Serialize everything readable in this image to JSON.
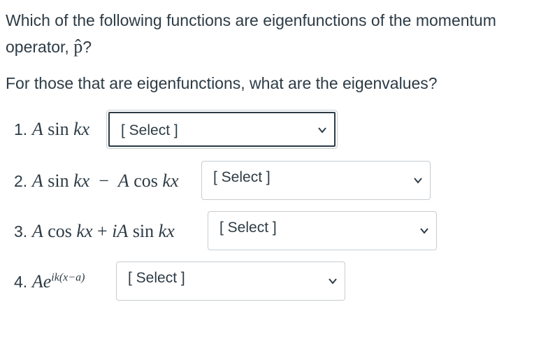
{
  "question": {
    "line1": "Which of the following functions are eigenfunctions of the momentum",
    "line2_text": "operator, ",
    "operator_symbol": "p̂",
    "line2_end": "?",
    "line3": "For those that are eigenfunctions, what are the eigenvalues?"
  },
  "items": [
    {
      "number": "1.",
      "select_label": "[ Select ]"
    },
    {
      "number": "2.",
      "select_label": "[ Select ]"
    },
    {
      "number": "3.",
      "select_label": "[ Select ]"
    },
    {
      "number": "4.",
      "select_label": "[ Select ]"
    }
  ],
  "math": {
    "f1": {
      "a": "A",
      "sin": "sin",
      "k": "k",
      "x": "x"
    },
    "f2": {
      "a": "A",
      "sin": "sin",
      "k": "k",
      "x": "x",
      "minus": "−",
      "a2": "A",
      "cos": "cos",
      "k2": "k",
      "x2": "x"
    },
    "f3": {
      "a": "A",
      "cos": "cos",
      "k": "k",
      "x": "x",
      "plus": "+",
      "i": "i",
      "a2": "A",
      "sin": "sin",
      "k2": "k",
      "x2": "x"
    },
    "f4": {
      "a": "A",
      "e": "e",
      "exponent": "ik(x−a)"
    }
  },
  "icons": {
    "chevron": "chevron-down-icon"
  },
  "colors": {
    "text": "#2d3b45",
    "border": "#c7cdd1"
  }
}
